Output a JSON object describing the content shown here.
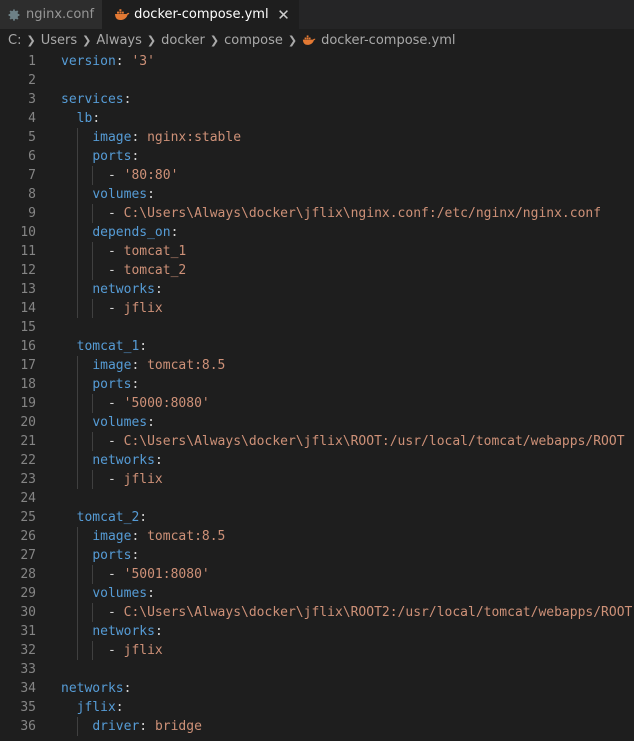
{
  "tabs": [
    {
      "label": "nginx.conf",
      "icon": "gear-icon",
      "active": false
    },
    {
      "label": "docker-compose.yml",
      "icon": "docker-whale-icon",
      "active": true
    }
  ],
  "tab_close_symbol": "✕",
  "breadcrumb": {
    "segments": [
      "C:",
      "Users",
      "Always",
      "docker",
      "compose"
    ],
    "file": "docker-compose.yml"
  },
  "colors": {
    "keyword": "#569cd6",
    "punctuation": "#d4d4d4",
    "string": "#ce9178",
    "line_number": "#858585",
    "background": "#1e1e1e",
    "docker_icon": "#e37933",
    "settings_icon": "#6d8086"
  },
  "lines": [
    {
      "n": "1",
      "tokens": [
        [
          "k",
          "version"
        ],
        [
          "p",
          ": "
        ],
        [
          "s",
          "'3'"
        ]
      ]
    },
    {
      "n": "2",
      "tokens": []
    },
    {
      "n": "3",
      "tokens": [
        [
          "k",
          "services"
        ],
        [
          "p",
          ":"
        ]
      ]
    },
    {
      "n": "4",
      "tokens": [
        [
          "p",
          "  "
        ],
        [
          "k",
          "lb"
        ],
        [
          "p",
          ":"
        ]
      ]
    },
    {
      "n": "5",
      "tokens": [
        [
          "p",
          "    "
        ],
        [
          "k",
          "image"
        ],
        [
          "p",
          ": "
        ],
        [
          "s",
          "nginx:stable"
        ]
      ]
    },
    {
      "n": "6",
      "tokens": [
        [
          "p",
          "    "
        ],
        [
          "k",
          "ports"
        ],
        [
          "p",
          ":"
        ]
      ]
    },
    {
      "n": "7",
      "tokens": [
        [
          "p",
          "      - "
        ],
        [
          "s",
          "'80:80'"
        ]
      ]
    },
    {
      "n": "8",
      "tokens": [
        [
          "p",
          "    "
        ],
        [
          "k",
          "volumes"
        ],
        [
          "p",
          ":"
        ]
      ]
    },
    {
      "n": "9",
      "tokens": [
        [
          "p",
          "      - "
        ],
        [
          "s",
          "C:\\Users\\Always\\docker\\jflix\\nginx.conf:/etc/nginx/nginx.conf"
        ]
      ]
    },
    {
      "n": "10",
      "tokens": [
        [
          "p",
          "    "
        ],
        [
          "k",
          "depends_on"
        ],
        [
          "p",
          ":"
        ]
      ]
    },
    {
      "n": "11",
      "tokens": [
        [
          "p",
          "      - "
        ],
        [
          "s",
          "tomcat_1"
        ]
      ]
    },
    {
      "n": "12",
      "tokens": [
        [
          "p",
          "      - "
        ],
        [
          "s",
          "tomcat_2"
        ]
      ]
    },
    {
      "n": "13",
      "tokens": [
        [
          "p",
          "    "
        ],
        [
          "k",
          "networks"
        ],
        [
          "p",
          ":"
        ]
      ]
    },
    {
      "n": "14",
      "tokens": [
        [
          "p",
          "      - "
        ],
        [
          "s",
          "jflix"
        ]
      ]
    },
    {
      "n": "15",
      "tokens": []
    },
    {
      "n": "16",
      "tokens": [
        [
          "p",
          "  "
        ],
        [
          "k",
          "tomcat_1"
        ],
        [
          "p",
          ":"
        ]
      ]
    },
    {
      "n": "17",
      "tokens": [
        [
          "p",
          "    "
        ],
        [
          "k",
          "image"
        ],
        [
          "p",
          ": "
        ],
        [
          "s",
          "tomcat:8.5"
        ]
      ]
    },
    {
      "n": "18",
      "tokens": [
        [
          "p",
          "    "
        ],
        [
          "k",
          "ports"
        ],
        [
          "p",
          ":"
        ]
      ]
    },
    {
      "n": "19",
      "tokens": [
        [
          "p",
          "      - "
        ],
        [
          "s",
          "'5000:8080'"
        ]
      ]
    },
    {
      "n": "20",
      "tokens": [
        [
          "p",
          "    "
        ],
        [
          "k",
          "volumes"
        ],
        [
          "p",
          ":"
        ]
      ]
    },
    {
      "n": "21",
      "tokens": [
        [
          "p",
          "      - "
        ],
        [
          "s",
          "C:\\Users\\Always\\docker\\jflix\\ROOT:/usr/local/tomcat/webapps/ROOT"
        ]
      ]
    },
    {
      "n": "22",
      "tokens": [
        [
          "p",
          "    "
        ],
        [
          "k",
          "networks"
        ],
        [
          "p",
          ":"
        ]
      ]
    },
    {
      "n": "23",
      "tokens": [
        [
          "p",
          "      - "
        ],
        [
          "s",
          "jflix"
        ]
      ]
    },
    {
      "n": "24",
      "tokens": []
    },
    {
      "n": "25",
      "tokens": [
        [
          "p",
          "  "
        ],
        [
          "k",
          "tomcat_2"
        ],
        [
          "p",
          ":"
        ]
      ]
    },
    {
      "n": "26",
      "tokens": [
        [
          "p",
          "    "
        ],
        [
          "k",
          "image"
        ],
        [
          "p",
          ": "
        ],
        [
          "s",
          "tomcat:8.5"
        ]
      ]
    },
    {
      "n": "27",
      "tokens": [
        [
          "p",
          "    "
        ],
        [
          "k",
          "ports"
        ],
        [
          "p",
          ":"
        ]
      ]
    },
    {
      "n": "28",
      "tokens": [
        [
          "p",
          "      - "
        ],
        [
          "s",
          "'5001:8080'"
        ]
      ]
    },
    {
      "n": "29",
      "tokens": [
        [
          "p",
          "    "
        ],
        [
          "k",
          "volumes"
        ],
        [
          "p",
          ":"
        ]
      ]
    },
    {
      "n": "30",
      "tokens": [
        [
          "p",
          "      - "
        ],
        [
          "s",
          "C:\\Users\\Always\\docker\\jflix\\ROOT2:/usr/local/tomcat/webapps/ROOT"
        ]
      ]
    },
    {
      "n": "31",
      "tokens": [
        [
          "p",
          "    "
        ],
        [
          "k",
          "networks"
        ],
        [
          "p",
          ":"
        ]
      ]
    },
    {
      "n": "32",
      "tokens": [
        [
          "p",
          "      - "
        ],
        [
          "s",
          "jflix"
        ]
      ]
    },
    {
      "n": "33",
      "tokens": []
    },
    {
      "n": "34",
      "tokens": [
        [
          "k",
          "networks"
        ],
        [
          "p",
          ":"
        ]
      ]
    },
    {
      "n": "35",
      "tokens": [
        [
          "p",
          "  "
        ],
        [
          "k",
          "jflix"
        ],
        [
          "p",
          ":"
        ]
      ]
    },
    {
      "n": "36",
      "tokens": [
        [
          "p",
          "    "
        ],
        [
          "k",
          "driver"
        ],
        [
          "p",
          ": "
        ],
        [
          "s",
          "bridge"
        ]
      ]
    }
  ]
}
